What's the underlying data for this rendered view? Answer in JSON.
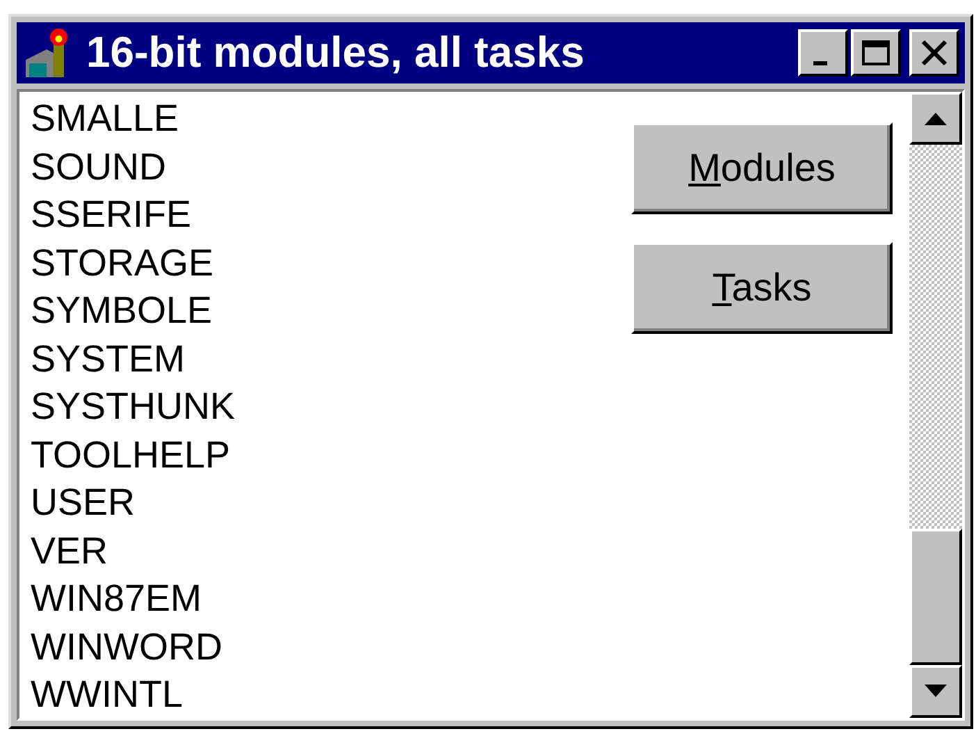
{
  "window": {
    "title": "16-bit modules, all tasks"
  },
  "modules": [
    "SMALLE",
    "SOUND",
    "SSERIFE",
    "STORAGE",
    "SYMBOLE",
    "SYSTEM",
    "SYSTHUNK",
    "TOOLHELP",
    "USER",
    "VER",
    "WIN87EM",
    "WINWORD",
    "WWINTL"
  ],
  "buttons": [
    {
      "access_key": "M",
      "rest": "odules"
    },
    {
      "access_key": "T",
      "rest": "asks"
    }
  ]
}
